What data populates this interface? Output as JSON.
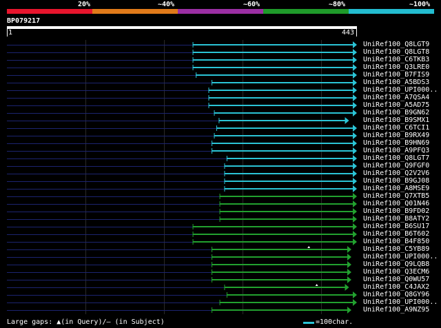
{
  "header": {
    "scale_labels": [
      "20%",
      "~40%",
      "~60%",
      "~80%",
      "~100%"
    ],
    "scale_colors": [
      "#e8152d",
      "#e07a1a",
      "#9b2fa3",
      "#1f9a2a",
      "#23bcd0"
    ],
    "query_id": "BP079217",
    "ruler_start": "1",
    "ruler_end": "443",
    "query_length": 443
  },
  "hits": [
    {
      "id": "UniRef100_Q8LGT9",
      "start": 236,
      "end": 443,
      "color": "cyan"
    },
    {
      "id": "UniRef100_Q8LGT8",
      "start": 236,
      "end": 443,
      "color": "cyan"
    },
    {
      "id": "UniRef100_C6TKB3",
      "start": 236,
      "end": 443,
      "color": "cyan"
    },
    {
      "id": "UniRef100_Q3LRE0",
      "start": 236,
      "end": 443,
      "color": "cyan"
    },
    {
      "id": "UniRef100_B7FIS9",
      "start": 240,
      "end": 443,
      "color": "cyan"
    },
    {
      "id": "UniRef100_A5BDS3",
      "start": 260,
      "end": 443,
      "color": "cyan"
    },
    {
      "id": "UniRef100_UPI000..",
      "start": 256,
      "end": 443,
      "color": "cyan"
    },
    {
      "id": "UniRef100_A7QSA4",
      "start": 256,
      "end": 443,
      "color": "cyan"
    },
    {
      "id": "UniRef100_A5AD75",
      "start": 256,
      "end": 443,
      "color": "cyan"
    },
    {
      "id": "UniRef100_B9GN62",
      "start": 263,
      "end": 443,
      "color": "cyan"
    },
    {
      "id": "UniRef100_B9SMX1",
      "start": 269,
      "end": 433,
      "color": "cyan"
    },
    {
      "id": "UniRef100_C6TCI1",
      "start": 266,
      "end": 443,
      "color": "cyan"
    },
    {
      "id": "UniRef100_B9RX49",
      "start": 263,
      "end": 443,
      "color": "cyan"
    },
    {
      "id": "UniRef100_B9HN69",
      "start": 260,
      "end": 443,
      "color": "cyan"
    },
    {
      "id": "UniRef100_A9PFQ3",
      "start": 260,
      "end": 443,
      "color": "cyan"
    },
    {
      "id": "UniRef100_Q8LGT7",
      "start": 279,
      "end": 443,
      "color": "cyan"
    },
    {
      "id": "UniRef100_Q9FGF0",
      "start": 276,
      "end": 443,
      "color": "cyan"
    },
    {
      "id": "UniRef100_Q2V2V6",
      "start": 276,
      "end": 443,
      "color": "cyan"
    },
    {
      "id": "UniRef100_B9GJ08",
      "start": 276,
      "end": 443,
      "color": "cyan"
    },
    {
      "id": "UniRef100_A8MSE9",
      "start": 276,
      "end": 443,
      "color": "cyan"
    },
    {
      "id": "UniRef100_Q7XTB5",
      "start": 270,
      "end": 443,
      "color": "green"
    },
    {
      "id": "UniRef100_Q01N46",
      "start": 270,
      "end": 443,
      "color": "green"
    },
    {
      "id": "UniRef100_B9FD02",
      "start": 270,
      "end": 443,
      "color": "green"
    },
    {
      "id": "UniRef100_B8ATY2",
      "start": 270,
      "end": 443,
      "color": "green"
    },
    {
      "id": "UniRef100_B6SU17",
      "start": 236,
      "end": 443,
      "color": "green"
    },
    {
      "id": "UniRef100_B6T602",
      "start": 236,
      "end": 443,
      "color": "green"
    },
    {
      "id": "UniRef100_B4F850",
      "start": 236,
      "end": 443,
      "color": "green"
    },
    {
      "id": "UniRef100_C5YB89",
      "start": 260,
      "end": 436,
      "color": "green"
    },
    {
      "id": "UniRef100_UPI000..",
      "start": 260,
      "end": 436,
      "color": "green"
    },
    {
      "id": "UniRef100_Q9LQB8",
      "start": 260,
      "end": 436,
      "color": "green"
    },
    {
      "id": "UniRef100_Q3ECM6",
      "start": 260,
      "end": 436,
      "color": "green"
    },
    {
      "id": "UniRef100_Q0WU57",
      "start": 260,
      "end": 436,
      "color": "green"
    },
    {
      "id": "UniRef100_C4JAX2",
      "start": 276,
      "end": 433,
      "color": "green"
    },
    {
      "id": "UniRef100_Q8GY96",
      "start": 279,
      "end": 443,
      "color": "green"
    },
    {
      "id": "UniRef100_UPI000..",
      "start": 270,
      "end": 443,
      "color": "green"
    },
    {
      "id": "UniRef100_A9NZ95",
      "start": 260,
      "end": 436,
      "color": "green"
    }
  ],
  "gap_marks": [
    {
      "row": 27,
      "pos": 383
    },
    {
      "row": 32,
      "pos": 393
    }
  ],
  "footer": {
    "gaps_label": "Large gaps: ▲(in Query)/— (in Subject)",
    "scale_label": "=100char."
  },
  "colors": {
    "cyan": "#2bc4d6",
    "green": "#22a12f",
    "navy": "#1c2470",
    "grid": "#2a2a2a"
  }
}
